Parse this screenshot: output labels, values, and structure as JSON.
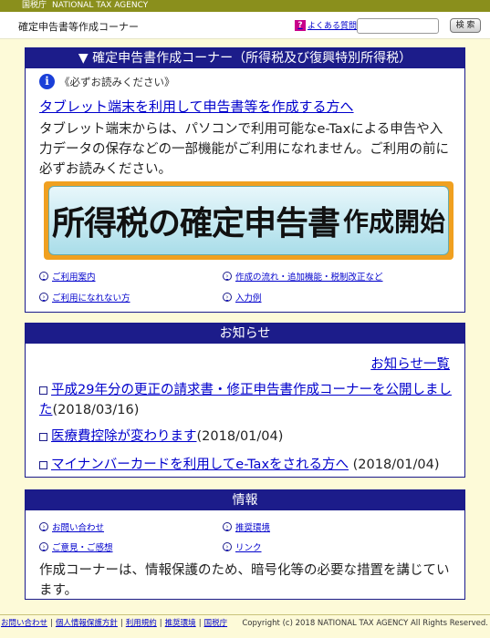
{
  "topbar": {
    "agency_jp": "国税庁",
    "agency_en": "NATIONAL TAX AGENCY"
  },
  "header": {
    "title": "確定申告書等作成コーナー",
    "faq_label": "よくある質問",
    "search_value": "",
    "search_button": "検 索"
  },
  "panel1": {
    "heading": "▼ 確定申告書作成コーナー（所得税及び復興特別所得税）",
    "notice_label": "《必ずお読みください》",
    "tablet_link": "タブレット端末を利用して申告書等を作成する方へ",
    "tablet_text": "タブレット端末からは、パソコンで利用可能なe-Taxによる申告や入力データの保存などの一部機能がご利用になれません。ご利用の前に必ずお読みください。",
    "start_button_main": "所得税の確定申告書",
    "start_button_sub": "作成開始",
    "links": [
      "ご利用案内",
      "作成の流れ・追加機能・税制改正など",
      "ご利用になれない方",
      "入力例"
    ]
  },
  "panel2": {
    "heading": "お知らせ",
    "all_link": "お知らせ一覧",
    "items": [
      {
        "link": "平成29年分の更正の請求書・修正申告書作成コーナーを公開しました",
        "date": "(2018/03/16)"
      },
      {
        "link": "医療費控除が変わります",
        "date": "(2018/01/04)"
      },
      {
        "link": "マイナンバーカードを利用してe-Taxをされる方へ",
        "date": " (2018/01/04)"
      }
    ]
  },
  "panel3": {
    "heading": "情報",
    "links": [
      "お問い合わせ",
      "推奨環境",
      "ご意見・ご感想",
      "リンク"
    ],
    "text": "作成コーナーは、情報保護のため、暗号化等の必要な措置を講じています。"
  },
  "footer": {
    "links": [
      "お問い合わせ",
      "個人情報保護方針",
      "利用規約",
      "推奨環境",
      "国税庁"
    ],
    "copyright": "Copyright (c) 2018 NATIONAL TAX AGENCY All Rights Reserved."
  }
}
